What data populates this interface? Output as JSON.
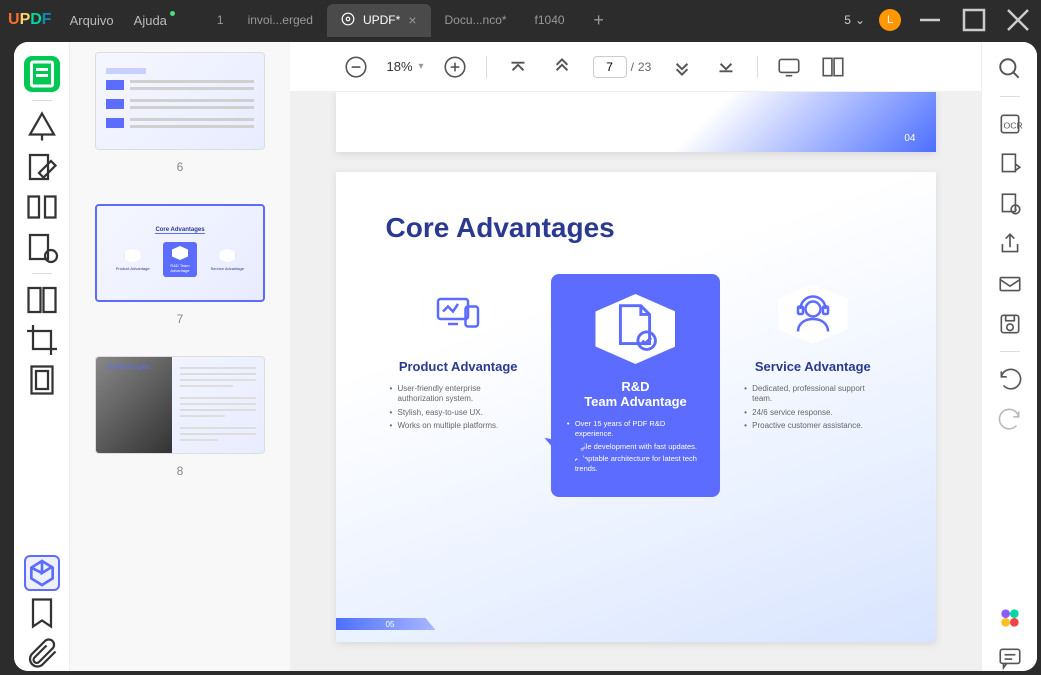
{
  "app": {
    "logo": "UPDF"
  },
  "menu": {
    "file": "Arquivo",
    "help": "Ajuda"
  },
  "tabs": {
    "num": "1",
    "items": [
      {
        "label": "invoi...erged"
      },
      {
        "label": "UPDF*"
      },
      {
        "label": "Docu...nco*"
      },
      {
        "label": "f1040"
      }
    ]
  },
  "cloud": {
    "count": "5"
  },
  "avatar": {
    "initial": "L"
  },
  "toolbar": {
    "zoom": "18%",
    "page_current": "7",
    "page_total": "23"
  },
  "thumbs": {
    "p6": "6",
    "p7": "7",
    "p8": "8",
    "t7_title": "Core Advantages",
    "t7_a": "Product Advantage",
    "t7_b": "R&D Team Advantage",
    "t7_c": "Service Advantage",
    "t8_title": "Growth Prospect"
  },
  "page_prev": {
    "num": "04"
  },
  "slide": {
    "title": "Core Advantages",
    "page_num": "05",
    "product": {
      "title": "Product Advantage",
      "b1": "User-friendly enterprise authorization system.",
      "b2": "Stylish, easy-to-use UX.",
      "b3": "Works on multiple platforms."
    },
    "rd": {
      "title1": "R&D",
      "title2": "Team Advantage",
      "b1": "Over 15 years of PDF R&D experience.",
      "b2": "Agile development with fast updates.",
      "b3": "Adaptable architecture for latest tech trends."
    },
    "service": {
      "title": "Service Advantage",
      "b1": "Dedicated, professional support team.",
      "b2": "24/6 service response.",
      "b3": "Proactive customer assistance."
    }
  }
}
